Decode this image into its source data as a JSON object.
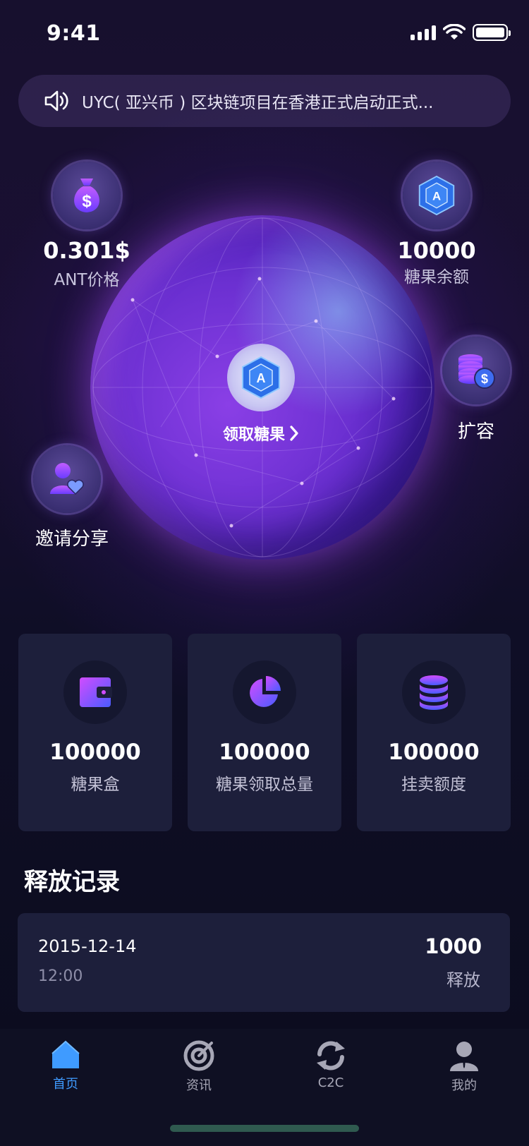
{
  "status": {
    "time": "9:41"
  },
  "notice": {
    "text": "UYC( 亚兴币 ) 区块链项目在香港正式启动正式..."
  },
  "price": {
    "value": "0.301$",
    "label": "ANT价格"
  },
  "balance": {
    "value": "10000",
    "label": "糖果余额"
  },
  "claim": {
    "label": "领取糖果"
  },
  "expand": {
    "label": "扩容"
  },
  "invite": {
    "label": "邀请分享"
  },
  "cards": [
    {
      "value": "100000",
      "label": "糖果盒",
      "icon": "wallet-icon"
    },
    {
      "value": "100000",
      "label": "糖果领取总量",
      "icon": "pie-chart-icon"
    },
    {
      "value": "100000",
      "label": "挂卖额度",
      "icon": "database-icon"
    }
  ],
  "records_title": "释放记录",
  "records": [
    {
      "date": "2015-12-14",
      "time": "12:00",
      "amount": "1000",
      "type": "释放"
    }
  ],
  "tabs": [
    {
      "label": "首页",
      "icon": "home-icon",
      "active": true
    },
    {
      "label": "资讯",
      "icon": "target-icon",
      "active": false
    },
    {
      "label": "C2C",
      "icon": "refresh-icon",
      "active": false
    },
    {
      "label": "我的",
      "icon": "user-icon",
      "active": false
    }
  ],
  "colors": {
    "accent": "#3f9bff",
    "card_bg": "#1d1f3b",
    "globe": "#7a35dc"
  }
}
